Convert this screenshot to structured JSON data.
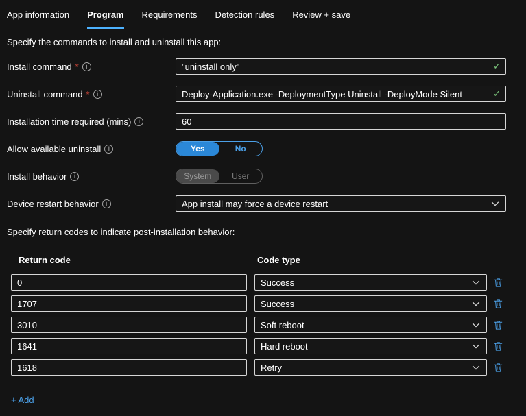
{
  "tabs": [
    {
      "label": "App information",
      "active": false
    },
    {
      "label": "Program",
      "active": true
    },
    {
      "label": "Requirements",
      "active": false
    },
    {
      "label": "Detection rules",
      "active": false
    },
    {
      "label": "Review + save",
      "active": false
    }
  ],
  "sections": {
    "commands_heading": "Specify the commands to install and uninstall this app:",
    "return_codes_heading": "Specify return codes to indicate post-installation behavior:"
  },
  "fields": {
    "install_command": {
      "label": "Install command",
      "value": "\"uninstall only\""
    },
    "uninstall_command": {
      "label": "Uninstall command",
      "value": "Deploy-Application.exe -DeploymentType Uninstall -DeployMode Silent"
    },
    "install_time": {
      "label": "Installation time required (mins)",
      "value": "60"
    },
    "allow_uninstall": {
      "label": "Allow available uninstall",
      "option_yes": "Yes",
      "option_no": "No",
      "selected": "Yes"
    },
    "install_behavior": {
      "label": "Install behavior",
      "option_system": "System",
      "option_user": "User",
      "selected": "System",
      "disabled": true
    },
    "restart_behavior": {
      "label": "Device restart behavior",
      "value": "App install may force a device restart"
    }
  },
  "return_codes": {
    "headers": {
      "code": "Return code",
      "type": "Code type"
    },
    "rows": [
      {
        "code": "0",
        "type": "Success"
      },
      {
        "code": "1707",
        "type": "Success"
      },
      {
        "code": "3010",
        "type": "Soft reboot"
      },
      {
        "code": "1641",
        "type": "Hard reboot"
      },
      {
        "code": "1618",
        "type": "Retry"
      }
    ]
  },
  "add_label": "+ Add",
  "colors": {
    "accent_blue": "#4ba0e8",
    "tab_underline": "#4db2ff",
    "toggle_selected": "#2b88d8",
    "valid_green": "#7cc67c",
    "required_red": "#f04e3e"
  }
}
